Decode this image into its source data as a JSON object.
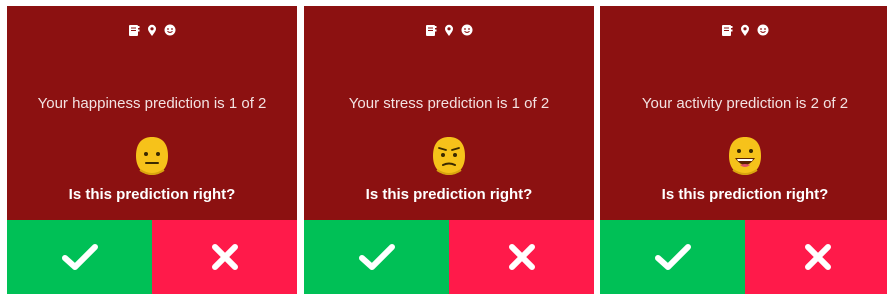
{
  "panels": [
    {
      "status_icons": [
        "notebook-icon",
        "location-pin-icon",
        "smiley-icon"
      ],
      "prediction_text": "Your happiness prediction is 1 of 2",
      "emoji": "neutral-face",
      "question": "Is this prediction right?",
      "confirm_icon": "checkmark-icon",
      "reject_icon": "cross-icon"
    },
    {
      "status_icons": [
        "notebook-icon",
        "location-pin-icon",
        "smiley-icon"
      ],
      "prediction_text": "Your stress prediction is 1 of 2",
      "emoji": "confused-face",
      "question": "Is this prediction right?",
      "confirm_icon": "checkmark-icon",
      "reject_icon": "cross-icon"
    },
    {
      "status_icons": [
        "notebook-icon",
        "location-pin-icon",
        "smiley-icon"
      ],
      "prediction_text": "Your activity prediction is 2 of 2",
      "emoji": "grinning-face",
      "question": "Is this prediction right?",
      "confirm_icon": "checkmark-icon",
      "reject_icon": "cross-icon"
    }
  ],
  "colors": {
    "background": "#8c1111",
    "confirm": "#00c056",
    "reject": "#ff1a4a",
    "text": "#ffffff",
    "emoji": "#f6c21a"
  }
}
